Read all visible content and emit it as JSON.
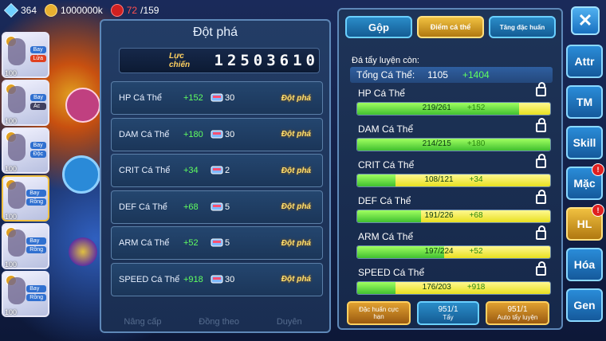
{
  "topbar": {
    "gems": "364",
    "gold": "1000000k",
    "stamina": "72",
    "stamina_max": "/159"
  },
  "team": [
    {
      "level": "100",
      "tags": [
        "Bay",
        "Lửa"
      ]
    },
    {
      "level": "100",
      "tags": [
        "Bay",
        "Ác"
      ]
    },
    {
      "level": "100",
      "tags": [
        "Bay",
        "Độc"
      ]
    },
    {
      "level": "100",
      "tags": [
        "Bay",
        "Rồng"
      ]
    },
    {
      "level": "100",
      "tags": [
        "Bay",
        "Rồng"
      ]
    },
    {
      "level": "100",
      "tags": [
        "Bay",
        "Rồng"
      ]
    }
  ],
  "breakthrough": {
    "title": "Đột phá",
    "power_label": "Lực chiến",
    "power_value": "12503610",
    "button_label": "Đột phá",
    "rows": [
      {
        "name": "HP Cá Thể",
        "bonus": "+152",
        "cost": "30"
      },
      {
        "name": "DAM Cá Thể",
        "bonus": "+180",
        "cost": "30"
      },
      {
        "name": "CRIT Cá Thể",
        "bonus": "+34",
        "cost": "2"
      },
      {
        "name": "DEF Cá Thể",
        "bonus": "+68",
        "cost": "5"
      },
      {
        "name": "ARM Cá Thể",
        "bonus": "+52",
        "cost": "5"
      },
      {
        "name": "SPEED Cá Thể",
        "bonus": "+918",
        "cost": "30"
      }
    ],
    "bottom_tabs": [
      "Nâng cấp",
      "Đồng theo",
      "Duyên"
    ]
  },
  "training": {
    "tabs": {
      "merge": "Gộp",
      "individual": "Điểm cá thể",
      "special": "Tăng đặc huấn"
    },
    "remaining_label": "Đá tẩy luyện còn:",
    "total_label": "Tổng Cá Thể:",
    "total_value": "1105",
    "total_bonus": "+1404",
    "stats": [
      {
        "name": "HP Cá Thể",
        "value": "219/261",
        "bonus": "+152",
        "fill": 0.84
      },
      {
        "name": "DAM Cá Thể",
        "value": "214/215",
        "bonus": "+180",
        "fill": 0.995
      },
      {
        "name": "CRIT Cá Thể",
        "value": "108/121",
        "bonus": "+34",
        "fill": 0.2
      },
      {
        "name": "DEF Cá Thể",
        "value": "191/226",
        "bonus": "+68",
        "fill": 0.33
      },
      {
        "name": "ARM Cá Thể",
        "value": "197/224",
        "bonus": "+52",
        "fill": 0.45
      },
      {
        "name": "SPEED Cá Thể",
        "value": "176/203",
        "bonus": "+918",
        "fill": 0.2
      }
    ],
    "actions": {
      "limit_label": "Đặc huấn cực hạn",
      "wash_count": "951/1",
      "wash_label": "Tẩy",
      "auto_count": "951/1",
      "auto_label": "Auto tẩy luyện"
    }
  },
  "side_menu": {
    "close": "✕",
    "items": [
      "Attr",
      "TM",
      "Skill",
      "Mặc",
      "HL",
      "Hóa",
      "Gen"
    ],
    "badge": "!"
  },
  "colors": {
    "accent_green": "#60ff60",
    "gold": "#f0c040",
    "panel_border": "#5e88b8"
  }
}
